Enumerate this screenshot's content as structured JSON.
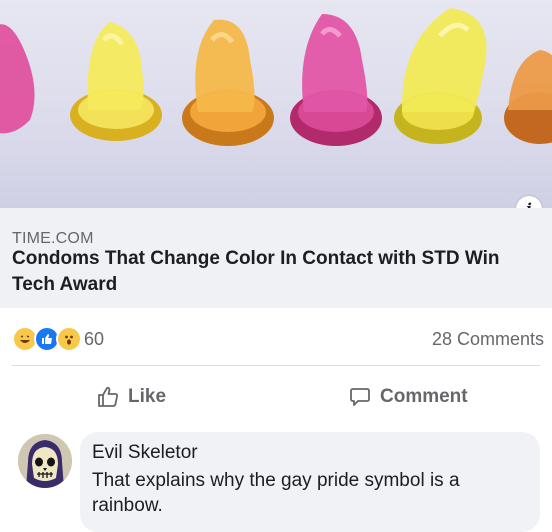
{
  "link": {
    "image_alt": "color-changing condoms",
    "info_label": "i",
    "domain": "TIME.COM",
    "title": "Condoms That Change Color In Contact with STD Win Tech Award"
  },
  "reactions": {
    "icons": [
      "haha-icon",
      "like-icon",
      "wow-icon"
    ],
    "count": "60",
    "comments": "28 Comments"
  },
  "actions": {
    "like_label": "Like",
    "comment_label": "Comment"
  },
  "comment": {
    "author": "Evil Skeletor",
    "text": "That explains why the gay pride symbol is a rainbow."
  },
  "colors": {
    "accent": "#1877f2",
    "muted_text": "#65676b",
    "caption_bg": "#f0f1f4",
    "bubble_bg": "#f0f2f5"
  }
}
